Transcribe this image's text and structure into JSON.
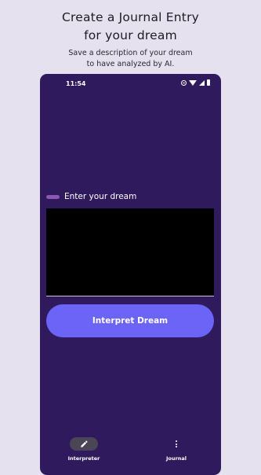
{
  "promo": {
    "headline_line1": "Create a Journal Entry",
    "headline_line2": "for your dream",
    "subline_line1": "Save a description of your dream",
    "subline_line2": "to have analyzed by AI."
  },
  "status_bar": {
    "time": "11:54",
    "icons": [
      "do-not-disturb-icon",
      "wifi-icon",
      "signal-icon",
      "battery-icon"
    ]
  },
  "form": {
    "label": "Enter your dream",
    "input_value": "",
    "button_label": "Interpret Dream"
  },
  "bottom_nav": {
    "items": [
      {
        "label": "Interpreter",
        "icon": "pencil-icon",
        "selected": true
      },
      {
        "label": "Journal",
        "icon": "more-vert-icon",
        "selected": false
      }
    ]
  },
  "colors": {
    "background": "#e6e1ee",
    "app_background": "#2e1a5c",
    "accent_button": "#6c63f7",
    "label_pill": "#8e55b8",
    "input_background": "#000000",
    "nav_indicator": "#4b4655"
  }
}
